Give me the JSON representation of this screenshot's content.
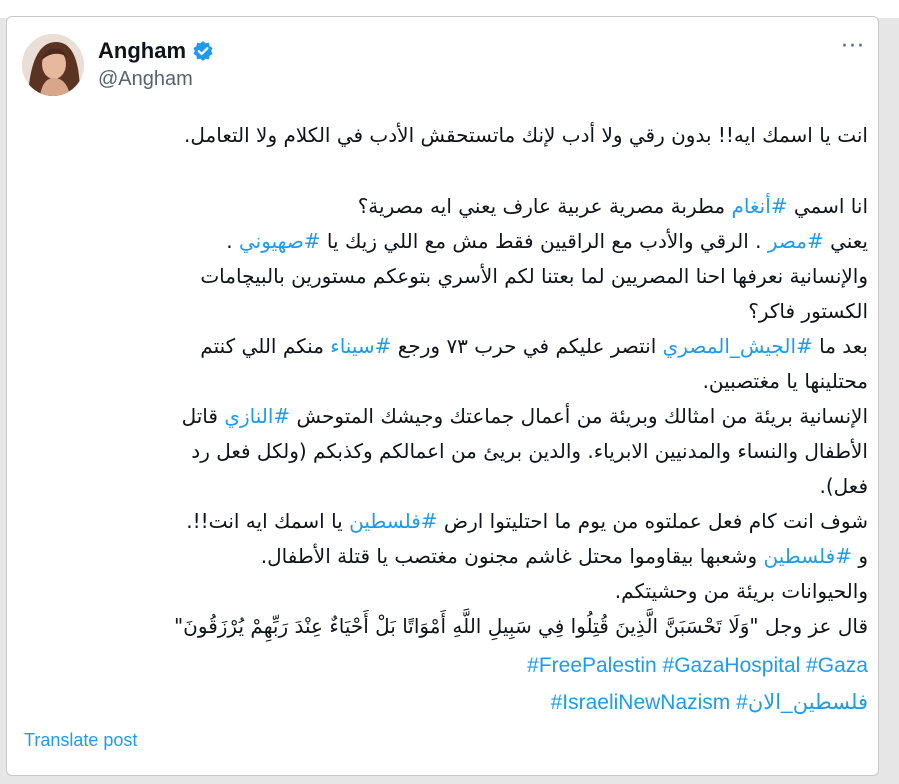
{
  "post": {
    "author_name": "Angham",
    "author_handle": "@Angham",
    "more_label": "···",
    "verified_badge_color": "#1d9bf0",
    "link_color": "#1d9bf0",
    "lines": [
      "انت يا اسمك ايه!! بدون رقي ولا أدب لإنك ماتستحقش الأدب في الكلام ولا التعامل.",
      "",
      "انا اسمي #أنغام مطربة مصرية عربية عارف يعني ايه مصرية؟",
      "يعني #مصر . الرقي والأدب مع الراقيين فقط مش مع اللي زيك يا #صهيوني .",
      "والإنسانية  نعرفها احنا المصريين لما بعتنا لكم الأسري بتوعكم مستورين بالبيچامات",
      "الكستور  فاكر؟",
      "بعد ما #الجيش_المصري انتصر عليكم في حرب ٧٣ ورجع #سيناء منكم اللي كنتم",
      "محتلينها يا مغتصبين.",
      "الإنسانية بريئة من امثالك وبريئة من أعمال جماعتك وجيشك المتوحش #النازي قاتل",
      "الأطفال والنساء والمدنيين الابرياء. والدين بريئ من اعمالكم وكذبكم  (ولكل فعل رد",
      "فعل).",
      "شوف انت  كام فعل عملتوه من يوم ما احتليتوا ارض  #فلسطين يا اسمك ايه انت!!.",
      "و #فلسطين وشعبها بيقاوموا محتل غاشم مجنون مغتصب  يا قتلة الأطفال.",
      "والحيوانات بريئة من وحشيتكم.",
      "قال عز وجل \"وَلَا تَحْسَبَنَّ الَّذِينَ قُتِلُوا فِي سَبِيلِ اللَّهِ أَمْوَاتًا بَلْ أَحْيَاءٌ عِنْدَ رَبِّهِمْ يُرْزَقُونَ\""
    ],
    "hashtag_line_1": "#FreePalestin  #GazaHospital #Gaza",
    "hashtag_line_2": "#IsraeliNewNazism #فلسطين_الان",
    "translate_label": "Translate post"
  }
}
